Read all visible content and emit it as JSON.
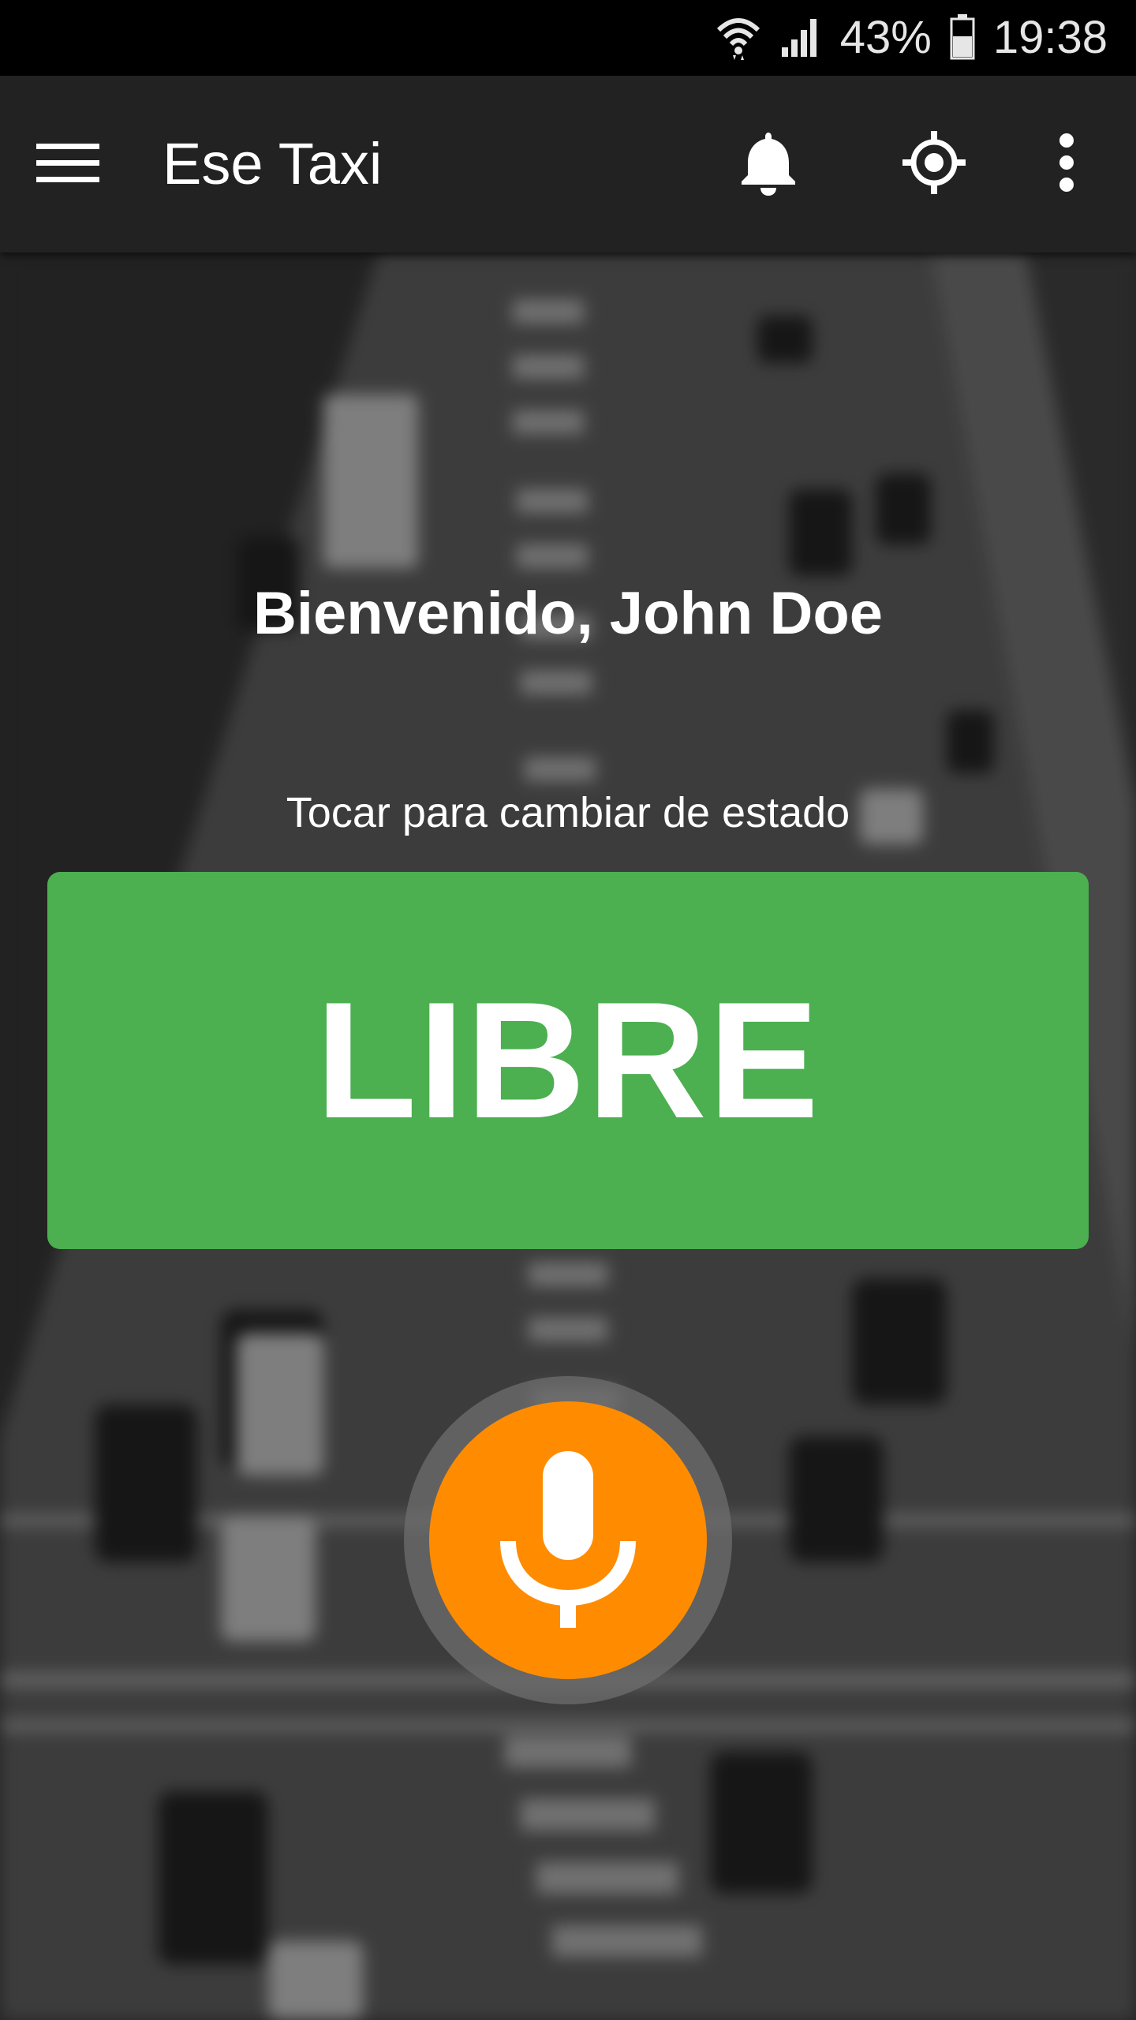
{
  "status_bar": {
    "battery": "43%",
    "time": "19:38",
    "icons": [
      "wifi-icon",
      "signal-icon",
      "battery-icon"
    ]
  },
  "app_bar": {
    "title": "Ese Taxi",
    "icons": [
      "menu-icon",
      "bell-icon",
      "locate-icon",
      "more-vert-icon"
    ]
  },
  "main": {
    "welcome": "Bienvenido, John Doe",
    "hint": "Tocar para cambiar de estado",
    "status_label": "LIBRE",
    "mic_icon": "microphone-icon"
  },
  "colors": {
    "status_free": "#4caf50",
    "mic_button": "#ff8c00",
    "app_bar": "#222222",
    "status_bar": "#000000"
  }
}
